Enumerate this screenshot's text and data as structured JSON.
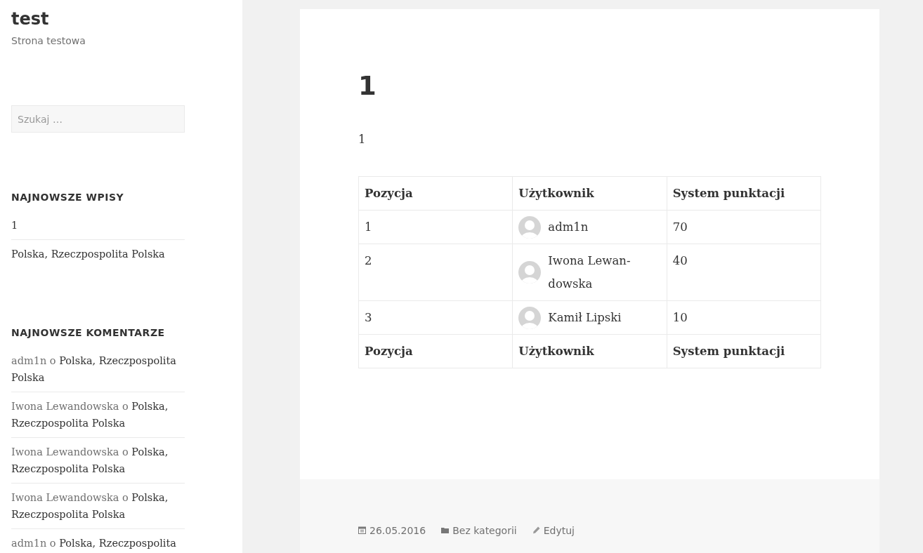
{
  "site": {
    "title": "test",
    "tagline": "Strona testowa"
  },
  "search": {
    "placeholder": "Szukaj …"
  },
  "widgets": [
    {
      "kind": "posts",
      "title": "NAJNOWSZE WPISY",
      "items": [
        {
          "text": "1"
        },
        {
          "text": "Polska, Rzeczpospolita Polska"
        }
      ]
    },
    {
      "kind": "comments",
      "title": "NAJNOWSZE KOMENTARZE",
      "items": [
        {
          "author": "adm1n",
          "connector": "o",
          "post": "Polska, Rzeczpospolita Polska"
        },
        {
          "author": "Iwona Lewandowska",
          "connector": "o",
          "post": "Polska, Rzeczpospolita Polska"
        },
        {
          "author": "Iwona Lewandowska",
          "connector": "o",
          "post": "Polska, Rzeczpospolita Polska"
        },
        {
          "author": "Iwona Lewandowska",
          "connector": "o",
          "post": "Polska, Rzeczpospolita Polska"
        },
        {
          "author": "adm1n",
          "connector": "o",
          "post": "Polska, Rzeczpospolita"
        }
      ]
    }
  ],
  "article": {
    "title": "1",
    "body": "1",
    "table": {
      "columns": [
        "Pozycja",
        "Użytkownik",
        "System punktacji"
      ],
      "rows": [
        [
          "1",
          "adm1n",
          "70"
        ],
        [
          "2",
          "Iwona Lewan-dowska",
          "40"
        ],
        [
          "3",
          "Kamił Lipski",
          "10"
        ]
      ],
      "footer": [
        "Pozycja",
        "Użytkownik",
        "System punktacji"
      ]
    },
    "meta": [
      {
        "kind": "date",
        "text": "26.05.2016"
      },
      {
        "kind": "category",
        "text": "Bez kategorii"
      },
      {
        "kind": "edit",
        "text": "Edytuj"
      }
    ]
  }
}
